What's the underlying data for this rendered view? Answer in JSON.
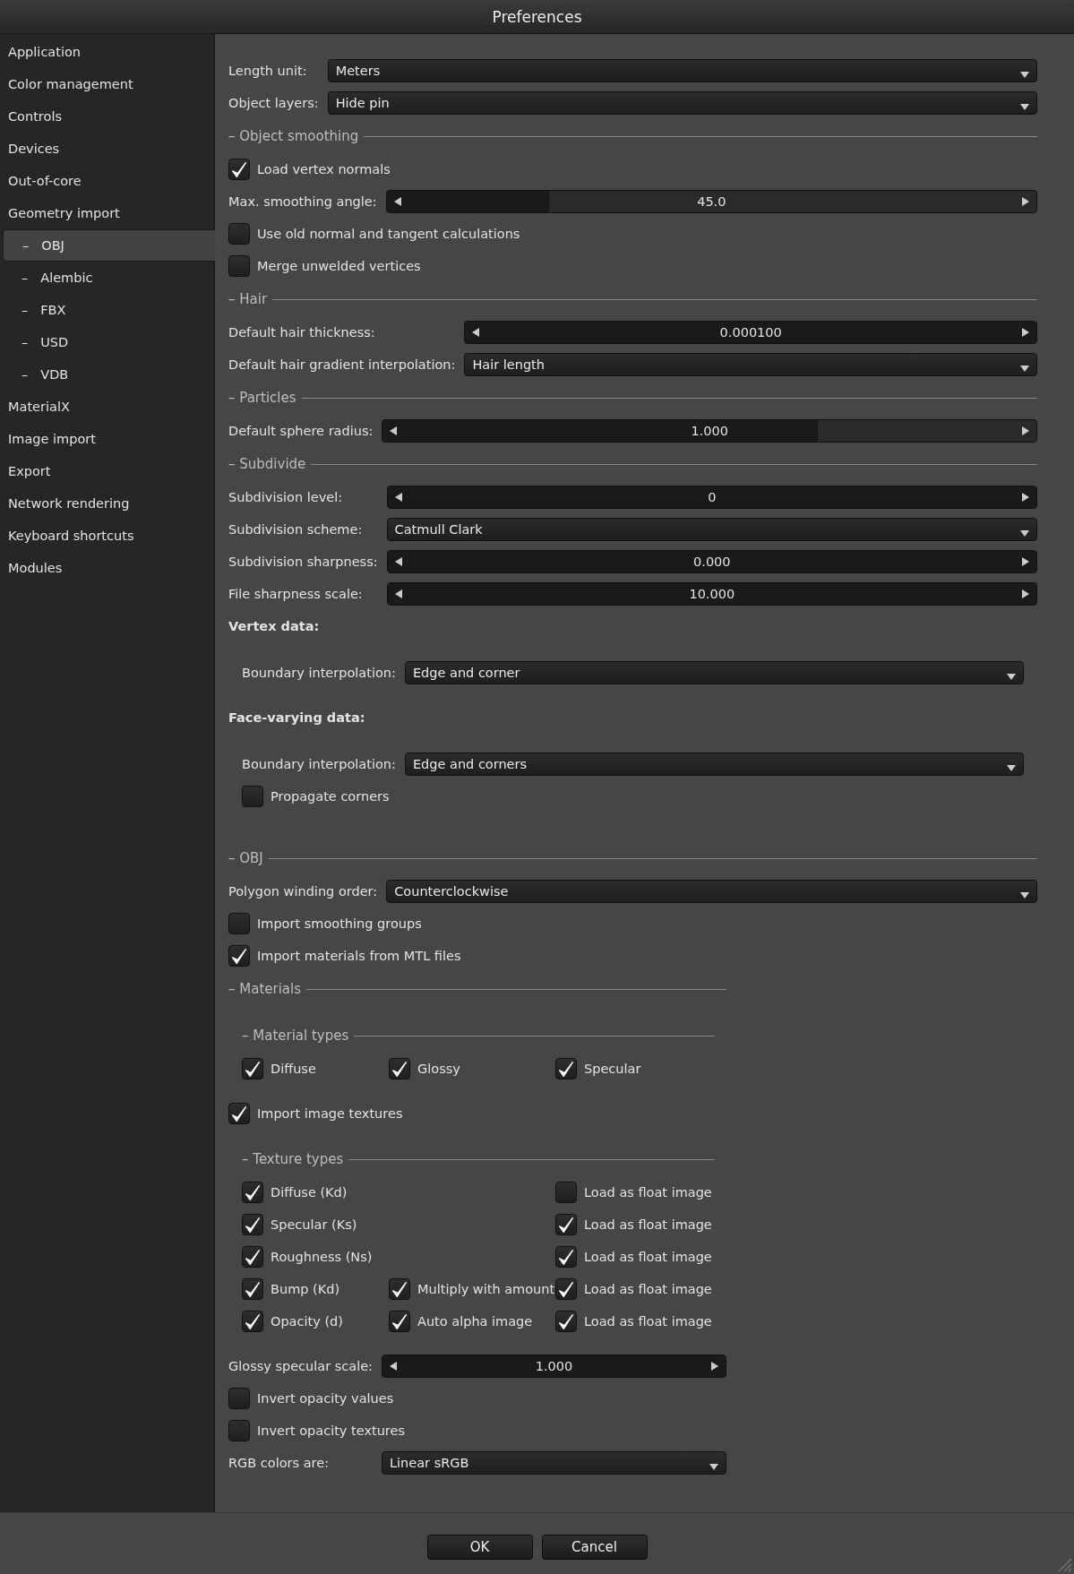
{
  "window": {
    "title": "Preferences"
  },
  "sidebar": [
    {
      "label": "Application",
      "selected": false
    },
    {
      "label": "Color management",
      "selected": false
    },
    {
      "label": "Controls",
      "selected": false
    },
    {
      "label": "Devices",
      "selected": false
    },
    {
      "label": "Out-of-core",
      "selected": false
    },
    {
      "label": "Geometry import",
      "selected": false,
      "children": [
        {
          "bullet": "–",
          "label": "OBJ",
          "selected": true
        },
        {
          "bullet": "–",
          "label": "Alembic",
          "selected": false
        },
        {
          "bullet": "–",
          "label": "FBX",
          "selected": false
        },
        {
          "bullet": "–",
          "label": "USD",
          "selected": false
        },
        {
          "bullet": "–",
          "label": "VDB",
          "selected": false
        }
      ]
    },
    {
      "label": "MaterialX",
      "selected": false
    },
    {
      "label": "Image import",
      "selected": false
    },
    {
      "label": "Export",
      "selected": false
    },
    {
      "label": "Network rendering",
      "selected": false
    },
    {
      "label": "Keyboard shortcuts",
      "selected": false
    },
    {
      "label": "Modules",
      "selected": false
    }
  ],
  "panel": [
    {
      "kind": "form",
      "rows": [
        {
          "kind": "dropdown",
          "label": "Length unit:",
          "value": "Meters"
        },
        {
          "kind": "dropdown",
          "label": "Object layers:",
          "value": "Hide pin"
        }
      ]
    },
    {
      "kind": "section",
      "title": "– Object smoothing",
      "rows": [
        {
          "kind": "checkbox",
          "label": "Load vertex normals",
          "checked": true
        },
        {
          "kind": "slider",
          "label": "Max. smoothing angle:",
          "value": "45.0",
          "level": 0.25
        },
        {
          "kind": "checkbox",
          "label": "Use old normal and tangent calculations",
          "checked": false
        },
        {
          "kind": "checkbox",
          "label": "Merge unwelded vertices",
          "checked": false
        }
      ]
    },
    {
      "kind": "section",
      "title": "– Hair",
      "rows": [
        {
          "kind": "slider",
          "label": "Default hair thickness:",
          "value": "0.000100",
          "level": 1
        },
        {
          "kind": "dropdown",
          "label": "Default hair gradient interpolation:",
          "value": "Hair length"
        }
      ]
    },
    {
      "kind": "section",
      "title": "– Particles",
      "rows": [
        {
          "kind": "slider",
          "label": "Default sphere radius:",
          "value": "1.000",
          "level": 0.665
        }
      ]
    },
    {
      "kind": "section",
      "title": "– Subdivide",
      "rows": [
        {
          "kind": "slider",
          "label": "Subdivision level:",
          "value": "0",
          "level": 1
        },
        {
          "kind": "dropdown",
          "label": "Subdivision scheme:",
          "value": "Catmull Clark"
        },
        {
          "kind": "slider",
          "label": "Subdivision sharpness:",
          "value": "0.000",
          "level": 1
        },
        {
          "kind": "slider",
          "label": "File sharpness scale:",
          "value": "10.000",
          "level": 1
        },
        {
          "kind": "heading",
          "text": "Vertex data:"
        },
        {
          "kind": "group",
          "rows": [
            {
              "kind": "dropdown",
              "label": "Boundary interpolation:",
              "value": "Edge and corner"
            }
          ]
        },
        {
          "kind": "heading",
          "text": "Face-varying data:"
        },
        {
          "kind": "group",
          "rows": [
            {
              "kind": "dropdown",
              "label": "Boundary interpolation:",
              "value": "Edge and corners"
            },
            {
              "kind": "checkbox",
              "label": "Propagate corners",
              "checked": false
            }
          ]
        }
      ]
    },
    {
      "kind": "section",
      "title": "– OBJ",
      "rows": [
        {
          "kind": "dropdown",
          "label": "Polygon winding order:",
          "value": "Counterclockwise"
        },
        {
          "kind": "checkbox",
          "label": "Import smoothing groups",
          "checked": false
        },
        {
          "kind": "checkbox",
          "label": "Import materials from MTL files",
          "checked": true
        },
        {
          "kind": "section",
          "title": "– Materials",
          "rows": [
            {
              "kind": "section",
              "title": "– Material types",
              "rows": [
                {
                  "kind": "checkgrid",
                  "rows": [
                    [
                      {
                        "label": "Diffuse",
                        "checked": true
                      },
                      {
                        "label": "Glossy",
                        "checked": true
                      },
                      {
                        "label": "Specular",
                        "checked": true
                      }
                    ]
                  ]
                }
              ]
            },
            {
              "kind": "checkbox",
              "label": "Import image textures",
              "checked": true
            },
            {
              "kind": "section",
              "title": "– Texture types",
              "rows": [
                {
                  "kind": "checkgrid",
                  "rows": [
                    [
                      {
                        "label": "Diffuse (Kd)",
                        "checked": true
                      },
                      null,
                      {
                        "label": "Load as float image",
                        "checked": false
                      }
                    ],
                    [
                      {
                        "label": "Specular (Ks)",
                        "checked": true
                      },
                      null,
                      {
                        "label": "Load as float image",
                        "checked": true
                      }
                    ],
                    [
                      {
                        "label": "Roughness (Ns)",
                        "checked": true
                      },
                      null,
                      {
                        "label": "Load as float image",
                        "checked": true
                      }
                    ],
                    [
                      {
                        "label": "Bump (Kd)",
                        "checked": true
                      },
                      {
                        "label": "Multiply with amount",
                        "checked": true
                      },
                      {
                        "label": "Load as float image",
                        "checked": true
                      }
                    ],
                    [
                      {
                        "label": "Opacity (d)",
                        "checked": true
                      },
                      {
                        "label": "Auto alpha image",
                        "checked": true
                      },
                      {
                        "label": "Load as float image",
                        "checked": true
                      }
                    ]
                  ]
                }
              ]
            },
            {
              "kind": "slider",
              "label": "Glossy specular scale:",
              "value": "1.000",
              "level": 1
            },
            {
              "kind": "checkbox",
              "label": "Invert opacity values",
              "checked": false
            },
            {
              "kind": "checkbox",
              "label": "Invert opacity textures",
              "checked": false
            },
            {
              "kind": "dropdown",
              "label": "RGB colors are:",
              "value": "Linear sRGB"
            }
          ]
        }
      ]
    }
  ],
  "buttons": [
    "OK",
    "Cancel"
  ]
}
